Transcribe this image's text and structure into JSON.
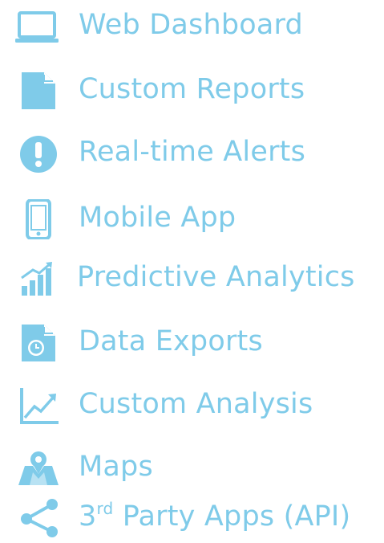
{
  "colors": {
    "accent": "#7fcbe9",
    "background": "#ffffff"
  },
  "features": [
    {
      "icon": "laptop-icon",
      "label": "Web Dashboard"
    },
    {
      "icon": "document-icon",
      "label": "Custom Reports"
    },
    {
      "icon": "alert-icon",
      "label": "Real-time Alerts"
    },
    {
      "icon": "mobile-phone-icon",
      "label": "Mobile App"
    },
    {
      "icon": "signal-bars-icon",
      "label": "Predictive Analytics"
    },
    {
      "icon": "clock-document-icon",
      "label": "Data Exports"
    },
    {
      "icon": "trend-chart-icon",
      "label": "Custom Analysis"
    },
    {
      "icon": "map-pin-icon",
      "label": "Maps"
    },
    {
      "icon": "share-icon",
      "label_prefix": "3",
      "label_sup": "rd",
      "label_suffix": " Party Apps (API)"
    }
  ]
}
